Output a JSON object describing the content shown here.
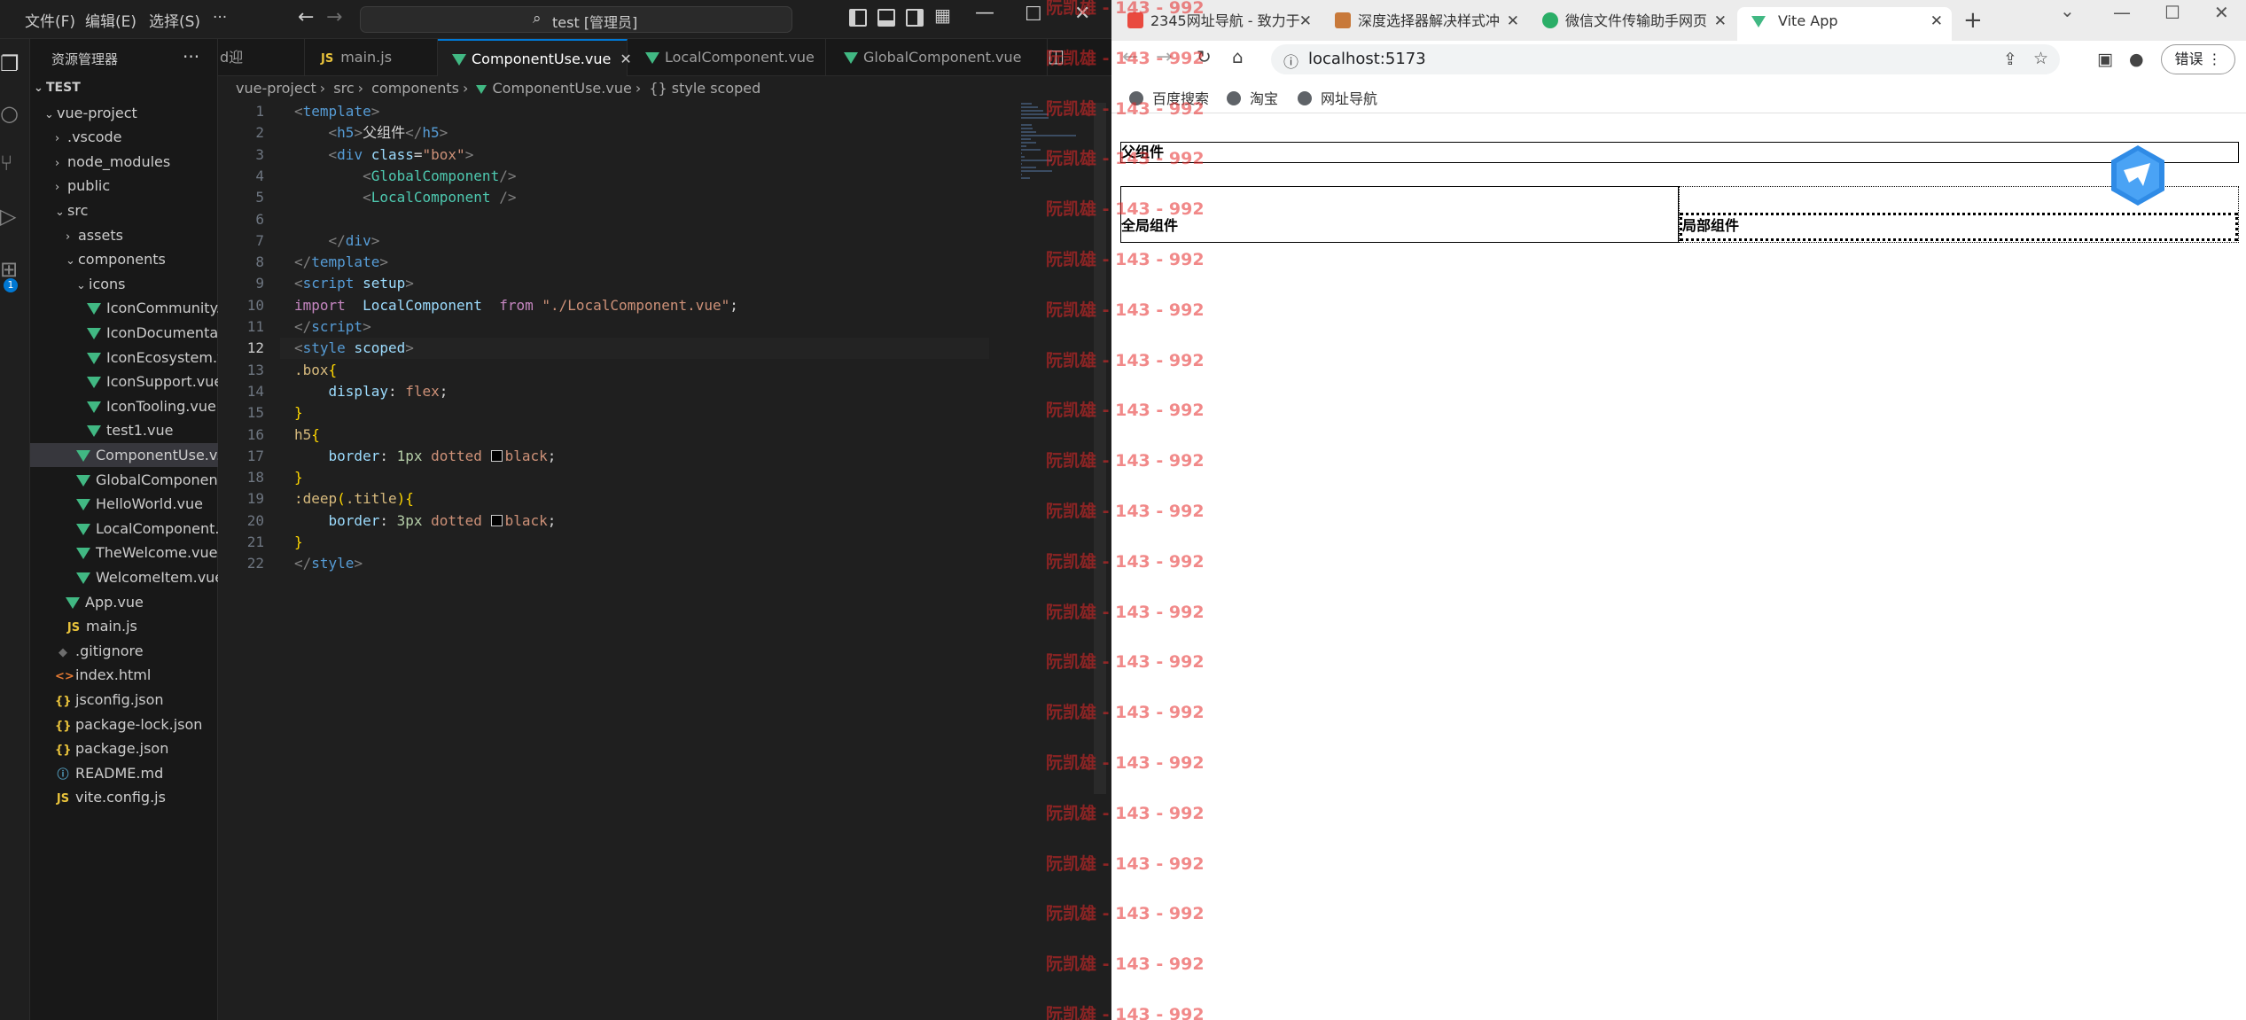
{
  "vscode": {
    "menu": [
      "文件(F)",
      "编辑(E)",
      "选择(S)",
      "···"
    ],
    "search_text": "test [管理员]",
    "sidebar_title": "资源管理器",
    "tree": [
      {
        "label": "TEST",
        "depth": 0,
        "type": "root"
      },
      {
        "label": "vue-project",
        "depth": 1,
        "type": "folder-open"
      },
      {
        "label": ".vscode",
        "depth": 2,
        "type": "folder"
      },
      {
        "label": "node_modules",
        "depth": 2,
        "type": "folder"
      },
      {
        "label": "public",
        "depth": 2,
        "type": "folder"
      },
      {
        "label": "src",
        "depth": 2,
        "type": "folder-open"
      },
      {
        "label": "assets",
        "depth": 3,
        "type": "folder"
      },
      {
        "label": "components",
        "depth": 3,
        "type": "folder-open"
      },
      {
        "label": "icons",
        "depth": 4,
        "type": "folder-open"
      },
      {
        "label": "IconCommunity...",
        "depth": 5,
        "type": "vue"
      },
      {
        "label": "IconDocumenta...",
        "depth": 5,
        "type": "vue"
      },
      {
        "label": "IconEcosystem.v...",
        "depth": 5,
        "type": "vue"
      },
      {
        "label": "IconSupport.vue",
        "depth": 5,
        "type": "vue"
      },
      {
        "label": "IconTooling.vue",
        "depth": 5,
        "type": "vue"
      },
      {
        "label": "test1.vue",
        "depth": 5,
        "type": "vue"
      },
      {
        "label": "ComponentUse.v...",
        "depth": 4,
        "type": "vue",
        "selected": true
      },
      {
        "label": "GlobalComponen...",
        "depth": 4,
        "type": "vue"
      },
      {
        "label": "HelloWorld.vue",
        "depth": 4,
        "type": "vue"
      },
      {
        "label": "LocalComponent....",
        "depth": 4,
        "type": "vue"
      },
      {
        "label": "TheWelcome.vue",
        "depth": 4,
        "type": "vue"
      },
      {
        "label": "WelcomeItem.vue",
        "depth": 4,
        "type": "vue"
      },
      {
        "label": "App.vue",
        "depth": 3,
        "type": "vue"
      },
      {
        "label": "main.js",
        "depth": 3,
        "type": "js"
      },
      {
        "label": ".gitignore",
        "depth": 2,
        "type": "git"
      },
      {
        "label": "index.html",
        "depth": 2,
        "type": "html"
      },
      {
        "label": "jsconfig.json",
        "depth": 2,
        "type": "json"
      },
      {
        "label": "package-lock.json",
        "depth": 2,
        "type": "json"
      },
      {
        "label": "package.json",
        "depth": 2,
        "type": "json"
      },
      {
        "label": "README.md",
        "depth": 2,
        "type": "info"
      },
      {
        "label": "vite.config.js",
        "depth": 2,
        "type": "js"
      }
    ],
    "tabs": [
      {
        "label": "d迎",
        "kind": "partial"
      },
      {
        "label": "main.js",
        "kind": "js"
      },
      {
        "label": "ComponentUse.vue",
        "kind": "vue",
        "active": true
      },
      {
        "label": "LocalComponent.vue",
        "kind": "vue"
      },
      {
        "label": "GlobalComponent.vue",
        "kind": "vue"
      }
    ],
    "breadcrumb": [
      "vue-project",
      "src",
      "components",
      "ComponentUse.vue",
      "{} style scoped"
    ],
    "current_line": 12,
    "code": [
      [
        [
          "t-br",
          "<"
        ],
        [
          "t-tag",
          "template"
        ],
        [
          "t-br",
          ">"
        ]
      ],
      [
        [
          "",
          "    "
        ],
        [
          "t-br",
          "<"
        ],
        [
          "t-tag",
          "h5"
        ],
        [
          "t-br",
          ">"
        ],
        [
          "t-txt",
          "父组件"
        ],
        [
          "t-br",
          "</"
        ],
        [
          "t-tag",
          "h5"
        ],
        [
          "t-br",
          ">"
        ]
      ],
      [
        [
          "",
          "    "
        ],
        [
          "t-br",
          "<"
        ],
        [
          "t-tag",
          "div"
        ],
        [
          "t-attr",
          " class"
        ],
        [
          "t-txt",
          "="
        ],
        [
          "t-str",
          "\"box\""
        ],
        [
          "t-br",
          ">"
        ]
      ],
      [
        [
          "",
          "        "
        ],
        [
          "t-br",
          "<"
        ],
        [
          "t-cls",
          "GlobalComponent"
        ],
        [
          "t-br",
          "/>"
        ]
      ],
      [
        [
          "",
          "        "
        ],
        [
          "t-br",
          "<"
        ],
        [
          "t-cls",
          "LocalComponent"
        ],
        [
          "t-br",
          " />"
        ]
      ],
      [
        [
          "",
          ""
        ]
      ],
      [
        [
          "",
          "    "
        ],
        [
          "t-br",
          "</"
        ],
        [
          "t-tag",
          "div"
        ],
        [
          "t-br",
          ">"
        ]
      ],
      [
        [
          "t-br",
          "</"
        ],
        [
          "t-tag",
          "template"
        ],
        [
          "t-br",
          ">"
        ]
      ],
      [
        [
          "t-br",
          "<"
        ],
        [
          "t-tag",
          "script"
        ],
        [
          "t-attr",
          " setup"
        ],
        [
          "t-br",
          ">"
        ]
      ],
      [
        [
          "t-kw",
          "import"
        ],
        [
          "t-txt",
          "  "
        ],
        [
          "t-prop",
          "LocalComponent"
        ],
        [
          "t-txt",
          "  "
        ],
        [
          "t-kw",
          "from"
        ],
        [
          "t-txt",
          " "
        ],
        [
          "t-str",
          "\"./LocalComponent.vue\""
        ],
        [
          "t-txt",
          ";"
        ]
      ],
      [
        [
          "t-br",
          "</"
        ],
        [
          "t-tag",
          "script"
        ],
        [
          "t-br",
          ">"
        ]
      ],
      [
        [
          "t-br",
          "<"
        ],
        [
          "t-tag",
          "style"
        ],
        [
          "t-attr",
          " scoped"
        ],
        [
          "t-br",
          ">"
        ]
      ],
      [
        [
          "t-sel",
          ".box"
        ],
        [
          "t-brc",
          "{"
        ]
      ],
      [
        [
          "",
          "    "
        ],
        [
          "t-prop",
          "display"
        ],
        [
          "t-txt",
          ": "
        ],
        [
          "t-val",
          "flex"
        ],
        [
          "t-txt",
          ";"
        ]
      ],
      [
        [
          "t-brc",
          "}"
        ]
      ],
      [
        [
          "t-sel",
          "h5"
        ],
        [
          "t-brc",
          "{"
        ]
      ],
      [
        [
          "",
          "    "
        ],
        [
          "t-prop",
          "border"
        ],
        [
          "t-txt",
          ": "
        ],
        [
          "t-num",
          "1px"
        ],
        [
          "t-txt",
          " "
        ],
        [
          "t-val",
          "dotted"
        ],
        [
          "t-txt",
          " "
        ],
        [
          "swatch",
          ""
        ],
        [
          "t-val",
          "black"
        ],
        [
          "t-txt",
          ";"
        ]
      ],
      [
        [
          "t-brc",
          "}"
        ]
      ],
      [
        [
          "t-sel",
          ":deep"
        ],
        [
          "t-brc",
          "("
        ],
        [
          "t-sel",
          ".title"
        ],
        [
          "t-brc",
          ")"
        ],
        [
          "t-brc",
          "{"
        ]
      ],
      [
        [
          "",
          "    "
        ],
        [
          "t-prop",
          "border"
        ],
        [
          "t-txt",
          ": "
        ],
        [
          "t-num",
          "3px"
        ],
        [
          "t-txt",
          " "
        ],
        [
          "t-val",
          "dotted"
        ],
        [
          "t-txt",
          " "
        ],
        [
          "swatch",
          ""
        ],
        [
          "t-val",
          "black"
        ],
        [
          "t-txt",
          ";"
        ]
      ],
      [
        [
          "t-brc",
          "}"
        ]
      ],
      [
        [
          "t-br",
          "</"
        ],
        [
          "t-tag",
          "style"
        ],
        [
          "t-br",
          ">"
        ]
      ]
    ]
  },
  "browser": {
    "tabs": [
      {
        "label": "2345网址导航 - 致力于",
        "fav_color": "#e94a3f"
      },
      {
        "label": "深度选择器解决样式冲",
        "fav_color": "#c8793a"
      },
      {
        "label": "微信文件传输助手网页",
        "fav_color": "#2aae67"
      },
      {
        "label": "Vite App",
        "fav_color": "#41b883",
        "active": true
      }
    ],
    "url": "localhost:5173",
    "profile_label": "错误",
    "bookmarks": [
      "百度搜索",
      "淘宝",
      "网址导航"
    ],
    "page": {
      "parent_title": "父组件",
      "global_text": "全局组件",
      "local_text": "局部组件"
    }
  },
  "watermark": {
    "text": "阮凯雄 - 143 - 992",
    "count": 21
  },
  "colors": {
    "vscode_bg": "#1f1f1f",
    "accent": "#0078d4",
    "vue_green": "#41b883",
    "watermark_red": "#e62828"
  }
}
